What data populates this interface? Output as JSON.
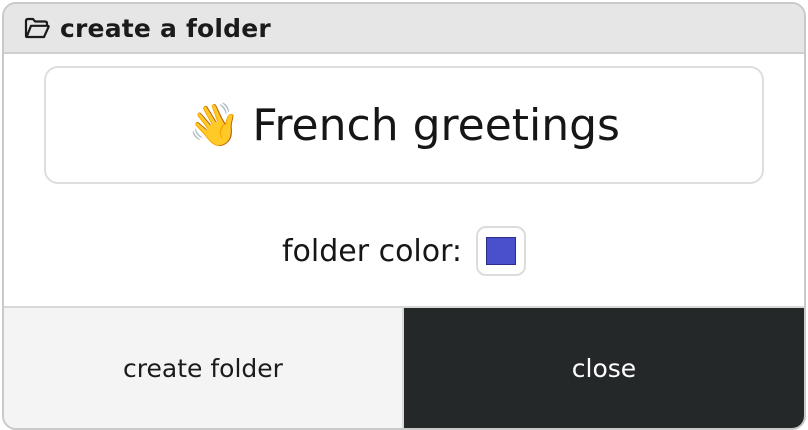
{
  "dialog": {
    "title": "create a folder",
    "title_icon": "folder-open-icon"
  },
  "folder_name": {
    "emoji": "👋",
    "value": "French greetings"
  },
  "folder_color": {
    "label": "folder color:",
    "value": "#4a4fcc"
  },
  "actions": {
    "create_label": "create folder",
    "close_label": "close"
  },
  "colors": {
    "titlebar_bg": "#e6e6e6",
    "close_bg": "#252829",
    "create_bg": "#f4f4f4"
  }
}
